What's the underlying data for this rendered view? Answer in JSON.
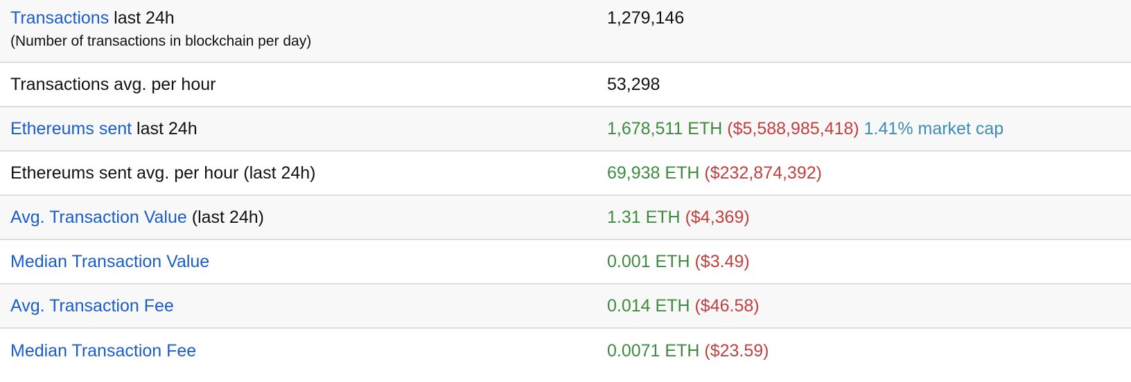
{
  "rows": [
    {
      "label_link": "Transactions",
      "label_rest": " last 24h",
      "sublabel": "(Number of transactions in blockchain per day)",
      "value": "1,279,146"
    },
    {
      "label_text": "Transactions avg. per hour",
      "value": "53,298"
    },
    {
      "label_link": "Ethereums sent",
      "label_rest": " last 24h",
      "eth": "1,678,511 ETH",
      "usd": "($5,588,985,418)",
      "mcap": "1.41% market cap"
    },
    {
      "label_text": "Ethereums sent avg. per hour (last 24h)",
      "eth": "69,938 ETH",
      "usd": "($232,874,392)"
    },
    {
      "label_link": "Avg. Transaction Value",
      "label_rest": " (last 24h)",
      "eth": "1.31 ETH",
      "usd": "($4,369)"
    },
    {
      "label_link": "Median Transaction Value",
      "eth": "0.001 ETH",
      "usd": "($3.49)"
    },
    {
      "label_link": "Avg. Transaction Fee",
      "eth": "0.014 ETH",
      "usd": "($46.58)"
    },
    {
      "label_link": "Median Transaction Fee",
      "eth": "0.0071 ETH",
      "usd": "($23.59)"
    }
  ],
  "colors": {
    "link": "#1a5dc8",
    "eth": "#3e8a3e",
    "usd": "#c0403f",
    "market_cap": "#3b8db5",
    "row_alt_bg": "#f8f8f8",
    "divider": "#dddddd"
  }
}
